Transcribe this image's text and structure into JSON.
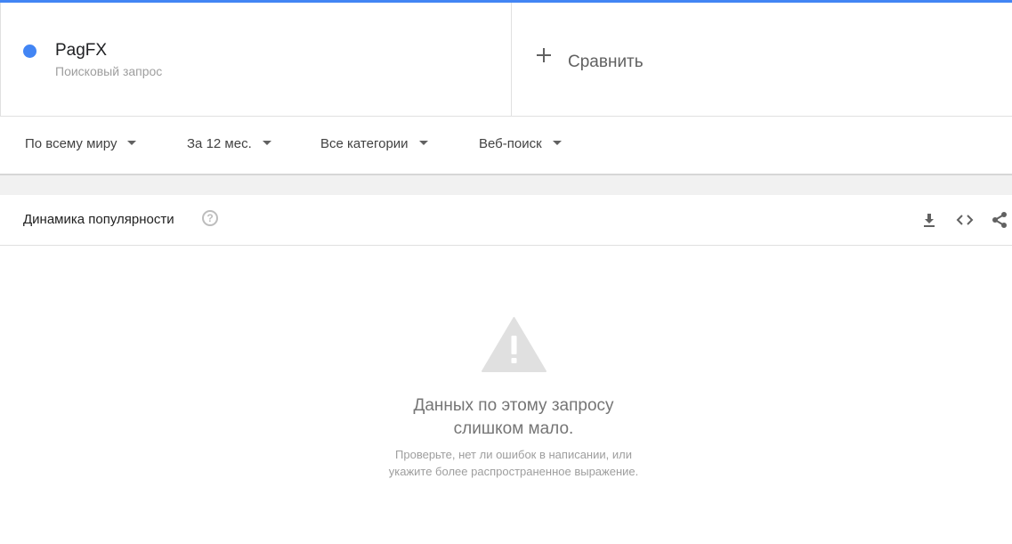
{
  "search_term": {
    "name": "PagFX",
    "subtitle": "Поисковый запрос",
    "color": "#4285f4"
  },
  "compare": {
    "label": "Сравнить",
    "icon": "plus-icon"
  },
  "filters": {
    "region": "По всему миру",
    "period": "За 12 мес.",
    "category": "Все категории",
    "search_type": "Веб-поиск"
  },
  "card": {
    "title": "Динамика популярности",
    "help_icon": "help-circle-icon",
    "tools": [
      "download-icon",
      "embed-code-icon",
      "share-icon"
    ]
  },
  "empty_state": {
    "icon": "warning-icon",
    "line1": "Данных по этому запросу",
    "line2": "слишком мало.",
    "hint1": "Проверьте, нет ли ошибок в написании, или",
    "hint2": "укажите более распространенное выражение."
  }
}
